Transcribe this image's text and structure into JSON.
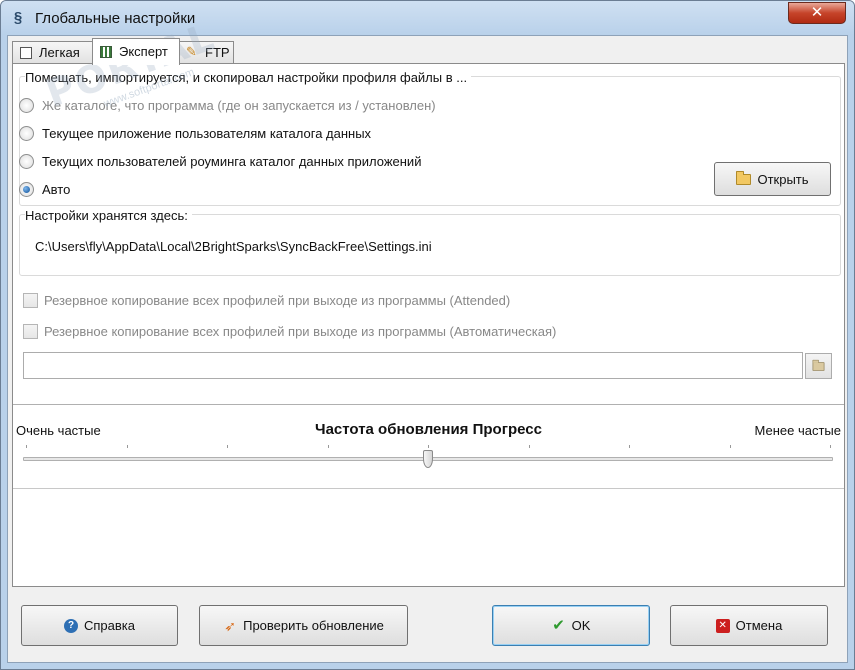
{
  "window": {
    "title": "Глобальные настройки",
    "close_label": "✕"
  },
  "tabs": [
    {
      "label": "Легкая",
      "icon": "checkbox-icon"
    },
    {
      "label": "Эксперт",
      "icon": "grid-icon"
    },
    {
      "label": "FTP",
      "icon": "ftp-icon"
    }
  ],
  "location_group": {
    "label": "Помещать, импортируется, и скопировал настройки профиля файлы в ...",
    "options": [
      {
        "label": "Же каталоге, что программа (где он запускается из / установлен)",
        "checked": false,
        "disabled": true
      },
      {
        "label": "Текущее приложение пользователям каталога данных",
        "checked": false,
        "disabled": false
      },
      {
        "label": "Текущих пользователей роуминга каталог данных приложений",
        "checked": false,
        "disabled": false
      },
      {
        "label": "Авто",
        "checked": true,
        "disabled": false
      }
    ],
    "open_button": "Открыть"
  },
  "stored_group": {
    "label": "Настройки хранятся здесь:",
    "path": "C:\\Users\\fly\\AppData\\Local\\2BrightSparks\\SyncBackFree\\Settings.ini"
  },
  "backup_options": [
    {
      "label": "Резервное копирование всех профилей при выходе из программы (Attended)",
      "checked": false
    },
    {
      "label": "Резервное копирование всех профилей при выходе из программы (Автоматическая)",
      "checked": false
    }
  ],
  "backup_path": {
    "value": "",
    "placeholder": ""
  },
  "progress_slider": {
    "title": "Частота обновления Прогресс",
    "left_label": "Очень частые",
    "right_label": "Менее частые",
    "tick_count": 9,
    "value_fraction": 0.5
  },
  "footer_buttons": {
    "help": "Справка",
    "check_update": "Проверить обновление",
    "ok": "OK",
    "cancel": "Отмена"
  },
  "watermark": {
    "main": "PORTAL",
    "sub": "www.softportal.com"
  },
  "colors": {
    "titlebar": "#b9d1ea",
    "close": "#c6442a",
    "help_icon": "#2e6fb4",
    "ok_icon": "#2f9a2f",
    "cancel_icon": "#cc1f1f"
  }
}
